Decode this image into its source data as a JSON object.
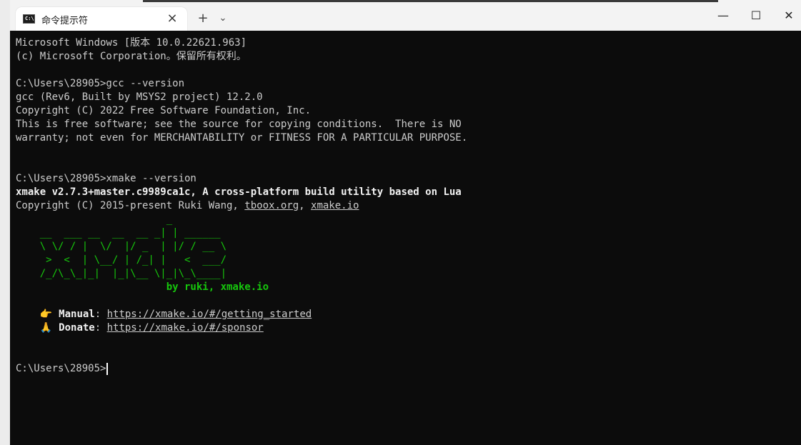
{
  "window": {
    "tab_title": "命令提示符",
    "tab_icon": "C:\\",
    "tab_close": "×",
    "new_tab": "+",
    "tab_dropdown": "⌄",
    "minimize": "—",
    "maximize": "☐",
    "close": "✕"
  },
  "terminal": {
    "line1": "Microsoft Windows [版本 10.0.22621.963]",
    "line2": "(c) Microsoft Corporation。保留所有权利。",
    "prompt1": "C:\\Users\\28905>gcc --version",
    "gcc1": "gcc (Rev6, Built by MSYS2 project) 12.2.0",
    "gcc2": "Copyright (C) 2022 Free Software Foundation, Inc.",
    "gcc3": "This is free software; see the source for copying conditions.  There is NO",
    "gcc4": "warranty; not even for MERCHANTABILITY or FITNESS FOR A PARTICULAR PURPOSE.",
    "prompt2": "C:\\Users\\28905>xmake --version",
    "xmake_version": "xmake v2.7.3+master.c9989ca1c, A cross-platform build utility based on Lua",
    "copyright_prefix": "Copyright (C) 2015-present Ruki Wang, ",
    "tboox_link": "tboox.org",
    "comma": ", ",
    "xmake_link": "xmake.io",
    "ascii": [
      "                         _",
      "    __  ___ __  __  __ _| | ______",
      "    \\ \\/ / |  \\/  |/ _  | |/ / __ \\",
      "     >  <  | \\__/ | /_| |   <  ___/",
      "    /_/\\_\\_|_|  |_|\\__ \\|_|\\_\\____|",
      "                         by ruki, xmake.io"
    ],
    "manual_emoji": "👉",
    "manual_label": "Manual",
    "manual_url": "https://xmake.io/#/getting_started",
    "donate_emoji": "🙏",
    "donate_label": "Donate",
    "donate_url": "https://xmake.io/#/sponsor",
    "prompt3": "C:\\Users\\28905>"
  }
}
